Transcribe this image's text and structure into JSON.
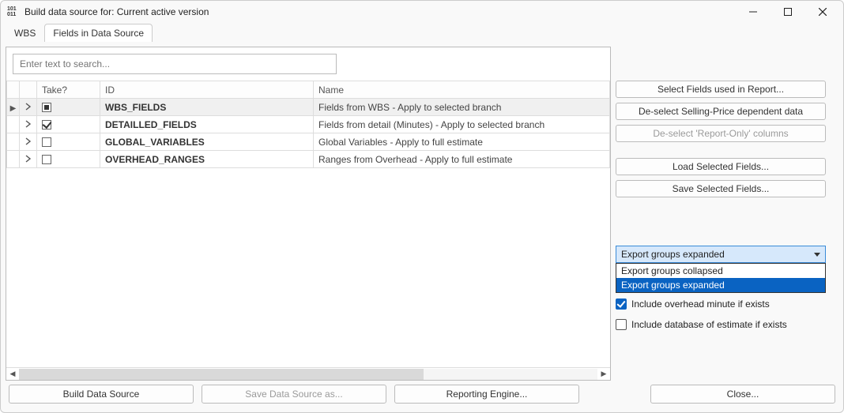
{
  "window": {
    "title": "Build data source for: Current active version"
  },
  "tabs": {
    "wbs": "WBS",
    "fields": "Fields in Data Source"
  },
  "search": {
    "placeholder": "Enter text to search..."
  },
  "grid": {
    "headers": {
      "take": "Take?",
      "id": "ID",
      "name": "Name"
    },
    "rows": [
      {
        "take_state": "indeterminate",
        "id": "WBS_FIELDS",
        "name": "Fields from WBS - Apply to selected branch",
        "selected": true
      },
      {
        "take_state": "checked",
        "id": "DETAILLED_FIELDS",
        "name": "Fields from detail (Minutes) - Apply to selected branch",
        "selected": false
      },
      {
        "take_state": "unchecked",
        "id": "GLOBAL_VARIABLES",
        "name": "Global Variables - Apply to full estimate",
        "selected": false
      },
      {
        "take_state": "unchecked",
        "id": "OVERHEAD_RANGES",
        "name": "Ranges from Overhead - Apply to full estimate",
        "selected": false
      }
    ]
  },
  "side": {
    "select_fields": "Select Fields used in Report...",
    "deselect_price": "De-select Selling-Price dependent data",
    "deselect_report": "De-select 'Report-Only' columns",
    "load_sel": "Load Selected Fields...",
    "save_sel": "Save Selected Fields...",
    "dropdown": {
      "selected": "Export groups expanded",
      "opt0": "Export groups collapsed",
      "opt1": "Export groups expanded"
    },
    "chk_overhead": "Include overhead minute if exists",
    "chk_db": "Include database of estimate if exists"
  },
  "footer": {
    "build": "Build Data Source",
    "save_as": "Save Data Source as...",
    "report": "Reporting Engine...",
    "close": "Close..."
  }
}
